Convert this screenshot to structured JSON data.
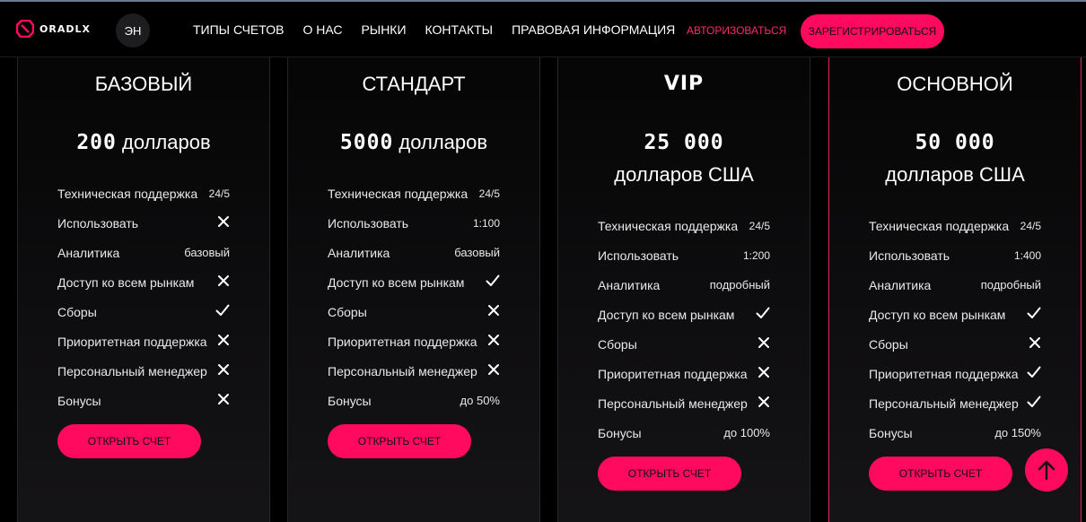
{
  "header": {
    "logo_text": "ORADLX",
    "lang": "ЭН",
    "nav": [
      "ТИПЫ СЧЕТОВ",
      "О НАС",
      "РЫНКИ",
      "КОНТАКТЫ",
      "ПРАВОВАЯ ИНФОРМАЦИЯ"
    ],
    "login_label": "АВТОРИЗОВАТЬСЯ",
    "register_label": "ЗАРЕГИСТРИРОВАТЬСЯ"
  },
  "colors": {
    "accent": "#ff0a5f",
    "login": "#ff2a6d",
    "featured_border": "#e0245a"
  },
  "cards": [
    {
      "title": "БАЗОВЫЙ",
      "price_num": "200",
      "price_unit": "долларов",
      "features": [
        {
          "label": "Техническая поддержка",
          "value": "24/5"
        },
        {
          "label": "Использовать",
          "value": "x-icon"
        },
        {
          "label": "Аналитика",
          "value": "базовый"
        },
        {
          "label": "Доступ ко всем рынкам",
          "value": "x-icon"
        },
        {
          "label": "Сборы",
          "value": "check-icon"
        },
        {
          "label": "Приоритетная поддержка",
          "value": "x-icon"
        },
        {
          "label": "Персональный менеджер",
          "value": "x-icon"
        },
        {
          "label": "Бонусы",
          "value": "x-icon"
        }
      ],
      "cta": "ОТКРЫТЬ СЧЕТ"
    },
    {
      "title": "СТАНДАРТ",
      "price_num": "5000",
      "price_unit": "долларов",
      "features": [
        {
          "label": "Техническая поддержка",
          "value": "24/5"
        },
        {
          "label": "Использовать",
          "value": "1:100"
        },
        {
          "label": "Аналитика",
          "value": "базовый"
        },
        {
          "label": "Доступ ко всем рынкам",
          "value": "check-icon"
        },
        {
          "label": "Сборы",
          "value": "x-icon"
        },
        {
          "label": "Приоритетная поддержка",
          "value": "x-icon"
        },
        {
          "label": "Персональный менеджер",
          "value": "x-icon"
        },
        {
          "label": "Бонусы",
          "value": "до 50%"
        }
      ],
      "cta": "ОТКРЫТЬ СЧЕТ"
    },
    {
      "title": "VIP",
      "price_num": "25 000",
      "price_unit": "долларов США",
      "features": [
        {
          "label": "Техническая поддержка",
          "value": "24/5"
        },
        {
          "label": "Использовать",
          "value": "1:200"
        },
        {
          "label": "Аналитика",
          "value": "подробный"
        },
        {
          "label": "Доступ ко всем рынкам",
          "value": "check-icon"
        },
        {
          "label": "Сборы",
          "value": "x-icon"
        },
        {
          "label": "Приоритетная поддержка",
          "value": "x-icon"
        },
        {
          "label": "Персональный менеджер",
          "value": "x-icon"
        },
        {
          "label": "Бонусы",
          "value": "до 100%"
        }
      ],
      "cta": "ОТКРЫТЬ СЧЕТ"
    },
    {
      "title": "ОСНОВНОЙ",
      "price_num": "50 000",
      "price_unit": "долларов США",
      "features": [
        {
          "label": "Техническая поддержка",
          "value": "24/5"
        },
        {
          "label": "Использовать",
          "value": "1:400"
        },
        {
          "label": "Аналитика",
          "value": "подробный"
        },
        {
          "label": "Доступ ко всем рынкам",
          "value": "check-icon"
        },
        {
          "label": "Сборы",
          "value": "x-icon"
        },
        {
          "label": "Приоритетная поддержка",
          "value": "check-icon"
        },
        {
          "label": "Персональный менеджер",
          "value": "check-icon"
        },
        {
          "label": "Бонусы",
          "value": "до 150%"
        }
      ],
      "cta": "ОТКРЫТЬ СЧЕТ"
    }
  ],
  "to_top_icon": "arrow-up-icon"
}
